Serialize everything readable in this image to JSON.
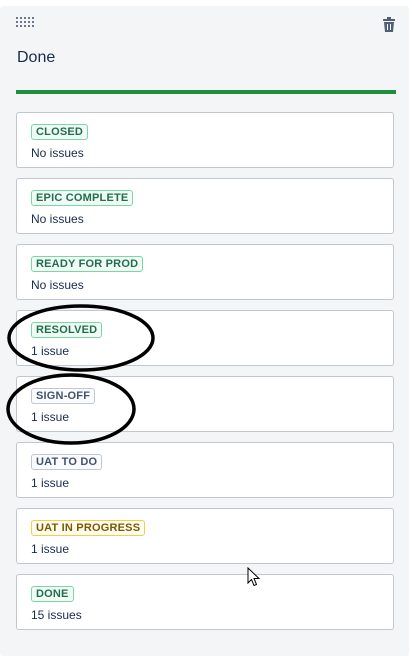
{
  "column": {
    "title": "Done",
    "bar_color": "#1f8e3d"
  },
  "cards": [
    {
      "status": "CLOSED",
      "count": "No issues",
      "tone": "green"
    },
    {
      "status": "EPIC COMPLETE",
      "count": "No issues",
      "tone": "green"
    },
    {
      "status": "READY FOR PROD",
      "count": "No issues",
      "tone": "green"
    },
    {
      "status": "RESOLVED",
      "count": "1 issue",
      "tone": "green"
    },
    {
      "status": "SIGN-OFF",
      "count": "1 issue",
      "tone": "grey"
    },
    {
      "status": "UAT TO DO",
      "count": "1 issue",
      "tone": "grey"
    },
    {
      "status": "UAT IN PROGRESS",
      "count": "1 issue",
      "tone": "yellow"
    },
    {
      "status": "DONE",
      "count": "15 issues",
      "tone": "green"
    }
  ],
  "icons": {
    "drag": "drag-handle-icon",
    "delete": "trash-icon",
    "cursor": "mouse-pointer-icon"
  }
}
